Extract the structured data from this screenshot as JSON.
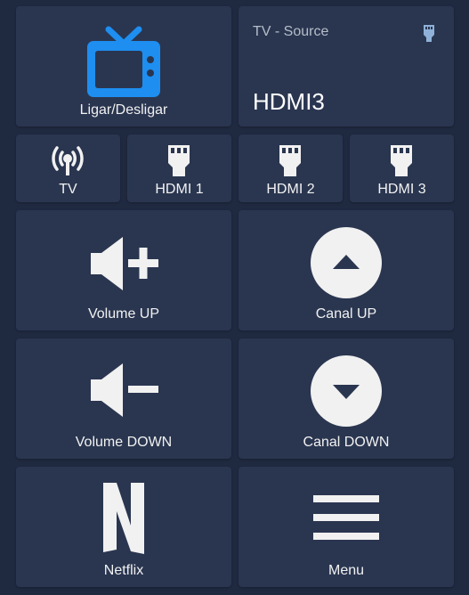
{
  "colors": {
    "background": "#1f2940",
    "card": "#2a3650",
    "tv_icon": "#1e8ef0",
    "text": "#f1f1f1",
    "secondary_text": "#b6bdc9",
    "source_icon": "#8fb1d8"
  },
  "power": {
    "icon": "tv-icon",
    "label": "Ligar/Desligar"
  },
  "source": {
    "title": "TV - Source",
    "value": "HDMI3",
    "icon": "hdmi-icon"
  },
  "inputs": [
    {
      "label": "TV",
      "icon": "antenna-icon"
    },
    {
      "label": "HDMI 1",
      "icon": "hdmi-icon"
    },
    {
      "label": "HDMI 2",
      "icon": "hdmi-icon"
    },
    {
      "label": "HDMI 3",
      "icon": "hdmi-icon"
    }
  ],
  "controls": {
    "volume_up": {
      "label": "Volume UP",
      "icon": "volume-plus-icon"
    },
    "channel_up": {
      "label": "Canal UP",
      "icon": "channel-up-icon"
    },
    "volume_down": {
      "label": "Volume DOWN",
      "icon": "volume-minus-icon"
    },
    "channel_down": {
      "label": "Canal DOWN",
      "icon": "channel-down-icon"
    },
    "netflix": {
      "label": "Netflix",
      "icon": "netflix-icon"
    },
    "menu": {
      "label": "Menu",
      "icon": "menu-icon"
    }
  }
}
